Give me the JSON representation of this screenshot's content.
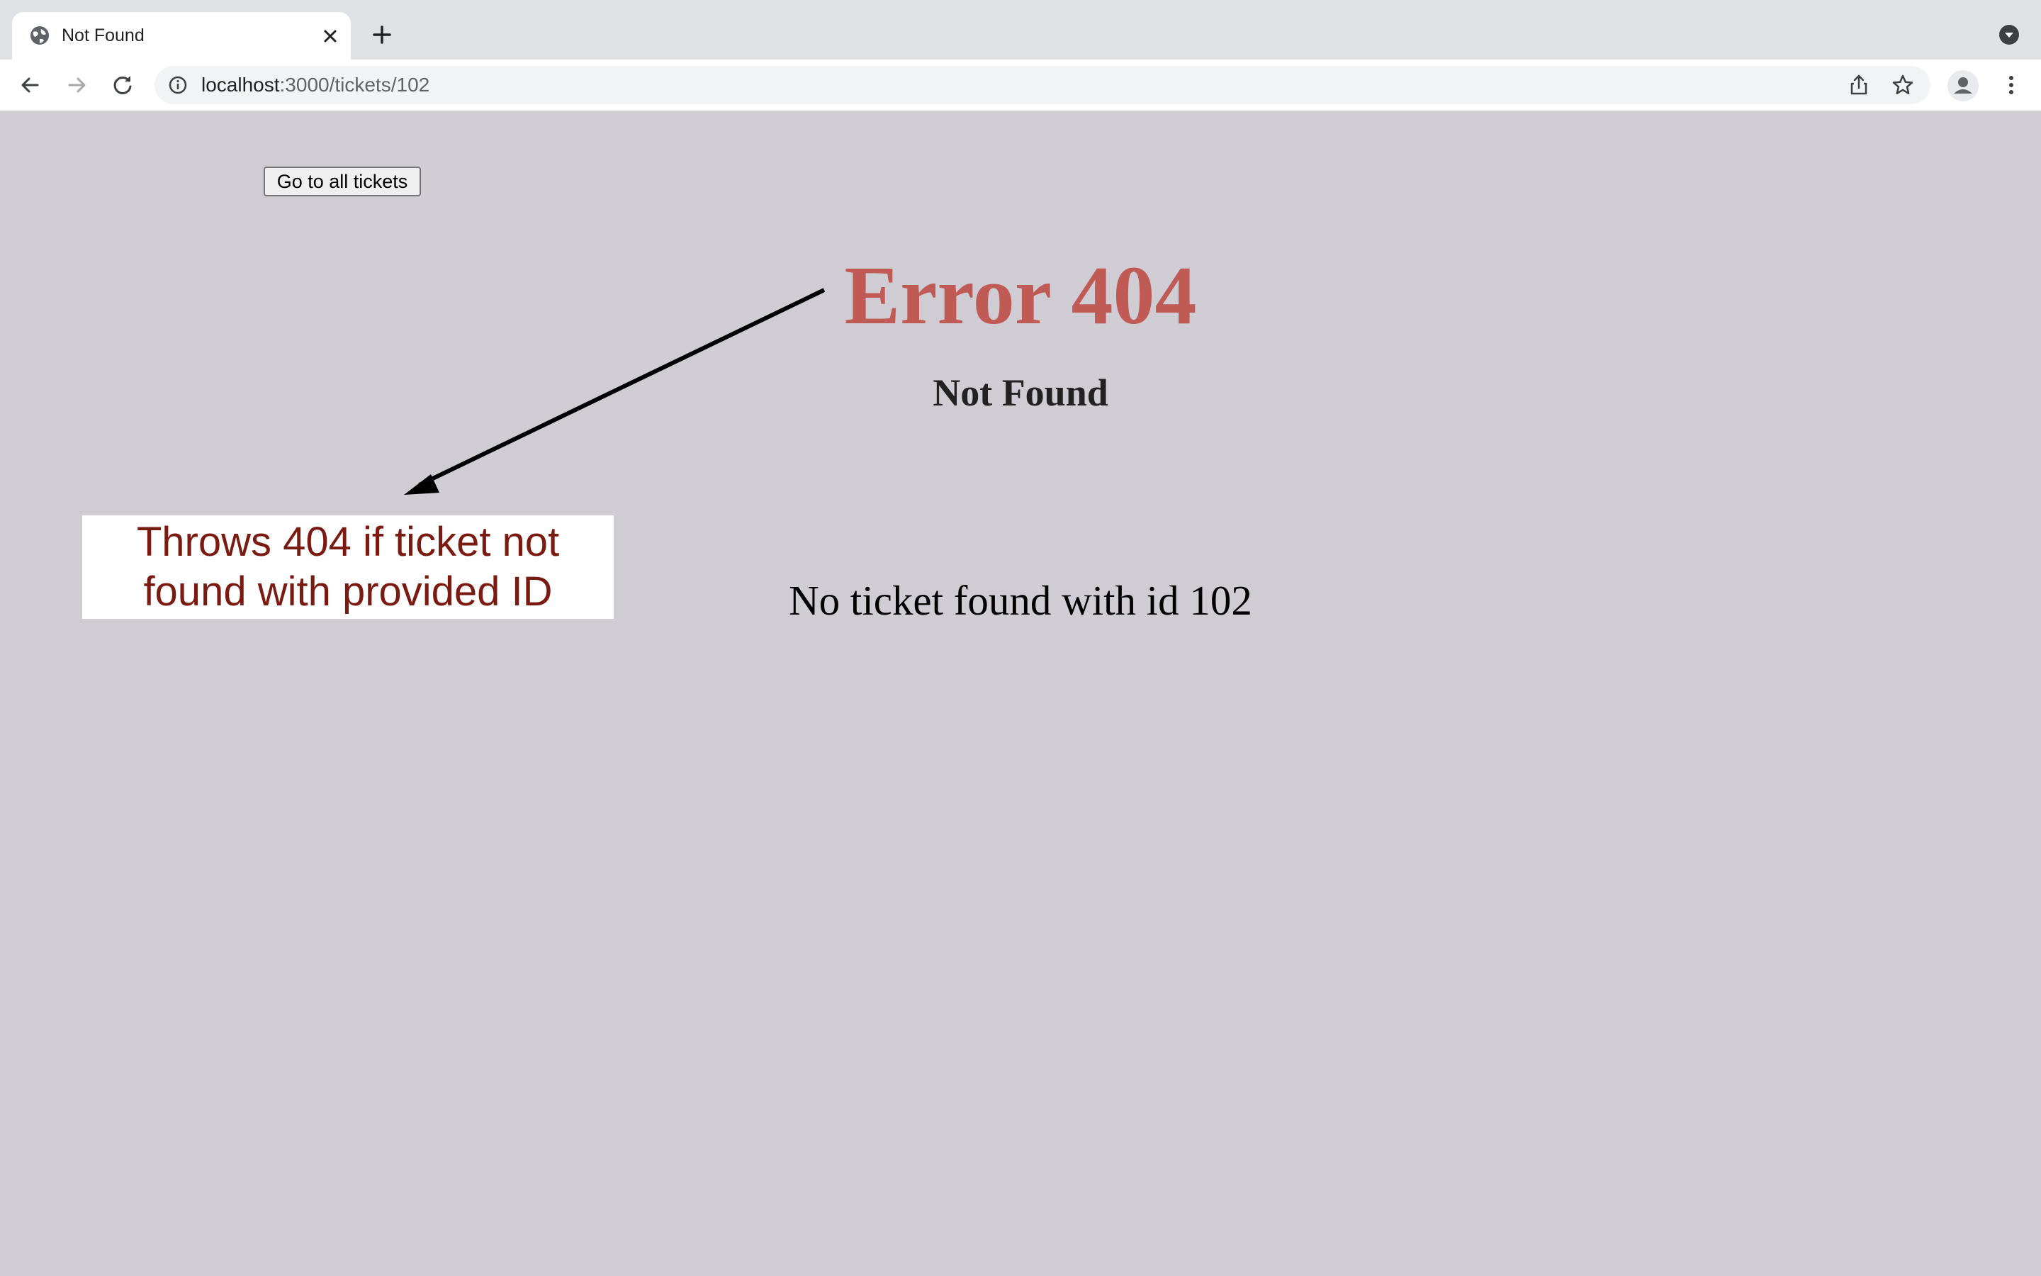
{
  "browser": {
    "tab": {
      "title": "Not Found",
      "favicon": "globe-icon",
      "close_icon": "close-icon"
    },
    "new_tab_icon": "plus-icon",
    "tab_search_icon": "chevron-down-circle-icon",
    "toolbar": {
      "back_icon": "arrow-left-icon",
      "forward_icon": "arrow-right-icon",
      "reload_icon": "reload-icon",
      "info_icon": "info-icon",
      "url_host": "localhost",
      "url_rest": ":3000/tickets/102",
      "share_icon": "share-icon",
      "bookmark_icon": "star-icon",
      "profile_icon": "person-icon",
      "menu_icon": "kebab-menu-icon"
    }
  },
  "page": {
    "back_button_label": "Go to all tickets",
    "error_title": "Error 404",
    "error_subtitle": "Not Found",
    "error_message": "No ticket found with id 102",
    "annotation": "Throws 404 if ticket not found with provided ID",
    "colors": {
      "background": "#d0ccd4",
      "error_title": "#c05a55",
      "annotation_text": "#7a1a10",
      "annotation_box": "#ffffff"
    }
  }
}
